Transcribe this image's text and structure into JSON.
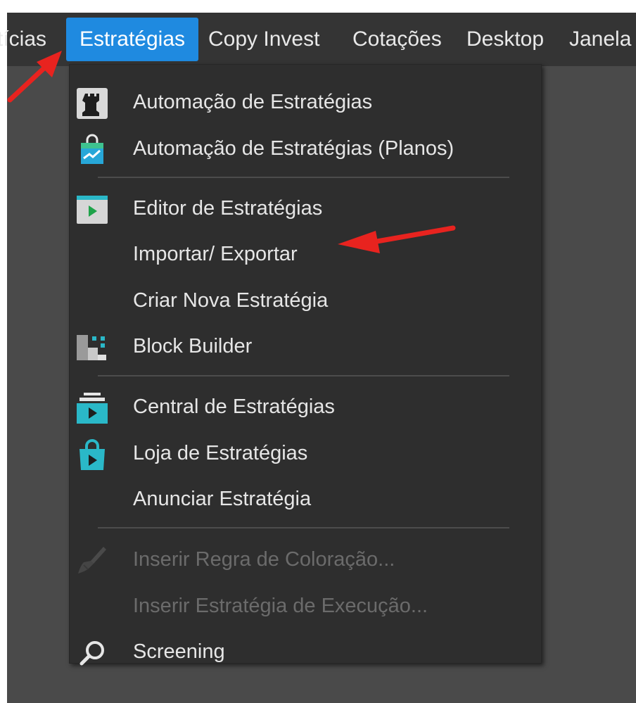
{
  "menubar": {
    "items": [
      {
        "label": "tícias"
      },
      {
        "label": "Estratégias"
      },
      {
        "label": "Copy Invest"
      },
      {
        "label": "Cotações"
      },
      {
        "label": "Desktop"
      },
      {
        "label": "Janela"
      }
    ]
  },
  "dropdown": {
    "items": [
      {
        "label": "Automação de Estratégias",
        "icon": "chess-rook-icon"
      },
      {
        "label": "Automação de Estratégias (Planos)",
        "icon": "shopping-bag-chart-icon"
      },
      {
        "label": "Editor de Estratégias",
        "icon": "play-window-icon"
      },
      {
        "label": "Importar/ Exportar",
        "icon": ""
      },
      {
        "label": "Criar Nova Estratégia",
        "icon": ""
      },
      {
        "label": "Block Builder",
        "icon": "blocks-icon"
      },
      {
        "label": "Central de Estratégias",
        "icon": "stack-play-icon"
      },
      {
        "label": "Loja de Estratégias",
        "icon": "shopping-bag-play-icon"
      },
      {
        "label": "Anunciar Estratégia",
        "icon": ""
      },
      {
        "label": "Inserir Regra de Coloração...",
        "icon": "paint-brush-icon",
        "disabled": true
      },
      {
        "label": "Inserir Estratégia de Execução...",
        "icon": "",
        "disabled": true
      },
      {
        "label": "Screening",
        "icon": "search-icon"
      }
    ]
  },
  "colors": {
    "menubar_bg": "#343434",
    "active_bg": "#1f8ae0",
    "dropdown_bg": "#2e2e2e",
    "annotation_arrow": "#e8231f",
    "icon_teal": "#2ab8c8"
  }
}
